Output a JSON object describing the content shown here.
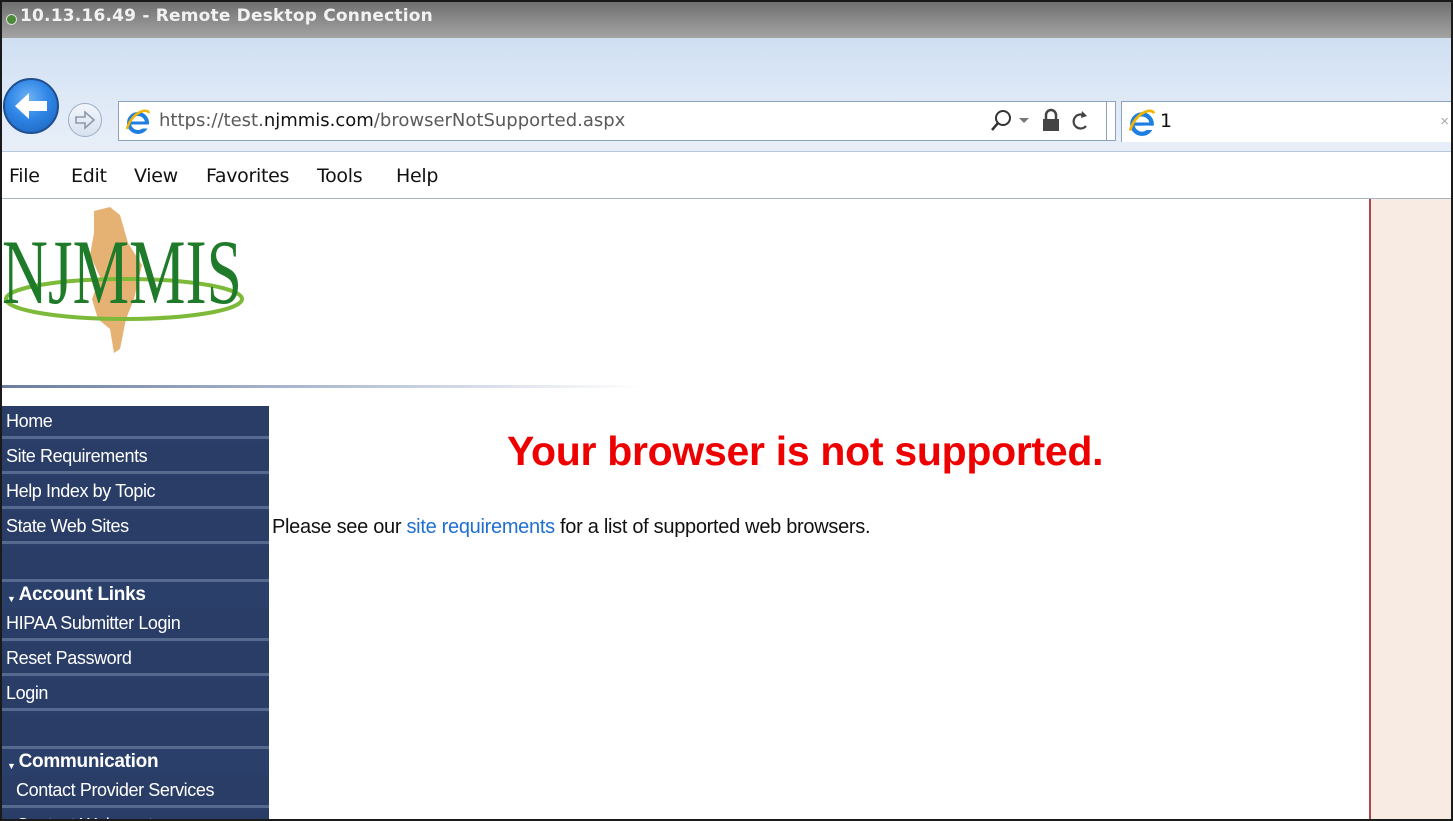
{
  "window": {
    "title": "10.13.16.49 - Remote Desktop Connection"
  },
  "browser": {
    "url_prefix": "https://test.",
    "url_host": "njmmis.com",
    "url_path": "/browserNotSupported.aspx",
    "tab_title": "1",
    "tab_close": "×",
    "menu": [
      "File",
      "Edit",
      "View",
      "Favorites",
      "Tools",
      "Help"
    ]
  },
  "logo": {
    "text": "NJMMIS"
  },
  "sidebar": {
    "items": [
      {
        "label": "Home"
      },
      {
        "label": "Site Requirements"
      },
      {
        "label": "Help Index by Topic"
      },
      {
        "label": "State Web Sites"
      }
    ],
    "account_heading": "Account Links",
    "account_items": [
      {
        "label": "HIPAA Submitter Login"
      },
      {
        "label": "Reset Password"
      },
      {
        "label": "Login"
      }
    ],
    "communication_heading": "Communication",
    "communication_items": [
      {
        "label": "Contact Provider Services"
      },
      {
        "label": "Contact Webmaster"
      }
    ]
  },
  "main": {
    "headline": "Your browser is not supported.",
    "message_before": "Please see our ",
    "message_link": "site requirements",
    "message_after": " for a list of supported web browsers."
  },
  "colors": {
    "headline": "#ee0000",
    "link": "#1f6fd1",
    "sidebar_bg": "#2a3d67"
  }
}
